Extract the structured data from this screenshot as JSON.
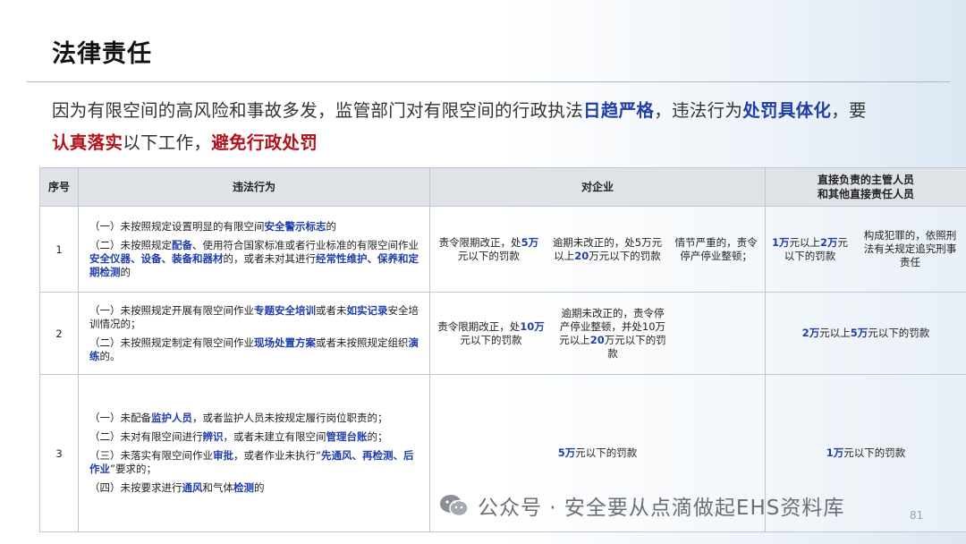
{
  "title": "法律责任",
  "intro": {
    "part1": "因为有限空间的高风险和事故多发，监管部门对有限空间的行政执法",
    "hl1": "日趋严格",
    "part2": "，违法行为",
    "hl2": "处罚具体化",
    "part3": "，要",
    "hl3": "认真落实",
    "part4": "以下工作，",
    "hl4": "避免行政处罚"
  },
  "table": {
    "headers": {
      "num": "序号",
      "act": "违法行为",
      "enterprise": "对企业",
      "manager_line1": "直接负责的主管人员",
      "manager_line2": "和其他直接责任人员"
    },
    "rows": [
      {
        "num": "1",
        "act": [
          {
            "a": "（一）未按照规定设置明显的有限空间",
            "h": "安全警示标志",
            "b": "的"
          },
          {
            "a": "（二）未按照规定",
            "h": "配备",
            "b": "、使用符合国家标准或者行业标准的有限空间作业",
            "h2": "安全仪器、设备、装备和器材",
            "b2": "的，或者未对其进行",
            "h3": "经常性维护、保养和定期检测",
            "b3": "的"
          }
        ],
        "ent": [
          {
            "a": "责令限期改正，处",
            "h": "5万",
            "b": "元以下的罚款"
          },
          {
            "a": "逾期未改正的，处5万元以上",
            "h": "20",
            "b": "万元以下的罚款"
          },
          {
            "a": "情节严重的，责令停产停业整顿；",
            "h": "",
            "b": ""
          }
        ],
        "mgr": [
          {
            "a": "",
            "h": "1万",
            "b": "元以上",
            "h2": "2万",
            "b2": "元以下的罚款"
          },
          {
            "a": "构成犯罪的，依照刑法有关规定追究刑事责任",
            "h": "",
            "b": ""
          }
        ]
      },
      {
        "num": "2",
        "act": [
          {
            "a": "（一）未按照规定开展有限空间作业",
            "h": "专题安全培训",
            "b": "或者未",
            "h2": "如实记录",
            "b2": "安全培训情况的；"
          },
          {
            "a": "（二）未按照规定制定有限空间作业",
            "h": "现场处置方案",
            "b": "或者未按照规定组织",
            "h2": "演练",
            "b2": "的。"
          }
        ],
        "ent": [
          {
            "a": "责令限期改正，处",
            "h": "10万",
            "b": "元以下的罚款"
          },
          {
            "a": "逾期未改正的，责令停产停业整顿，并处10万元以上",
            "h": "20",
            "b": "万元以下的罚款"
          }
        ],
        "mgr": [
          {
            "a": "",
            "h": "2万",
            "b": "元以上",
            "h2": "5万",
            "b2": "元以下的罚款"
          }
        ]
      },
      {
        "num": "3",
        "act": [
          {
            "a": "（一）未配备",
            "h": "监护人员",
            "b": "，或者监护人员未按规定履行岗位职责的；"
          },
          {
            "a": "（二）未对有限空间进行",
            "h": "辨识",
            "b": "，或者未建立有限空间",
            "h2": "管理台账",
            "b2": "的；"
          },
          {
            "a": "（三）未落实有限空间作业",
            "h": "审批",
            "b": "，或者作业未执行“",
            "h2": "先通风、再检测、后作业",
            "b2": "”要求的；"
          },
          {
            "a": "（四）未按要求进行",
            "h": "通风",
            "b": "和气体",
            "h2": "检测",
            "b2": "的"
          }
        ],
        "ent": [
          {
            "a": "",
            "h": "5万",
            "b": "元以下的罚款"
          }
        ],
        "mgr": [
          {
            "a": "",
            "h": "1万",
            "b": "元以下的罚款"
          }
        ]
      }
    ]
  },
  "watermark": "公众号 · 安全要从点滴做起EHS资料库",
  "page_number": "81",
  "colors": {
    "highlight_blue": "#1f3ea8",
    "highlight_red": "#b3121b",
    "header_bg": "#dfe2e7"
  }
}
